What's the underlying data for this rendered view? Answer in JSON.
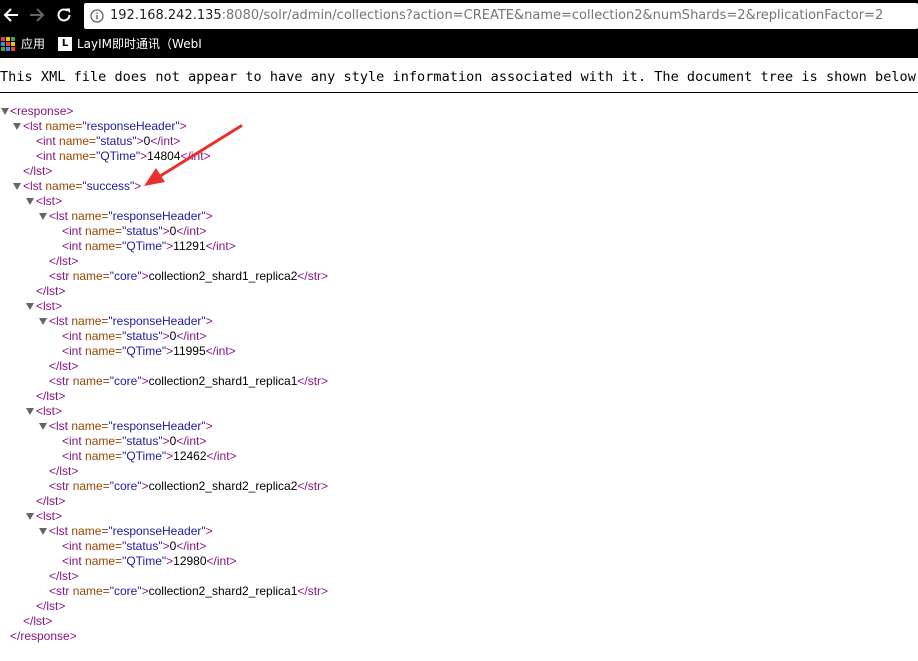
{
  "browser": {
    "url_host": "192.168.242.135",
    "url_rest": ":8080/solr/admin/collections?action=CREATE&name=collection2&numShards=2&replicationFactor=2",
    "bookmarks": [
      {
        "label": "应用"
      },
      {
        "label": "LayIM即时通讯（WebI"
      }
    ],
    "colors": {
      "chrome_bg": "#000000",
      "tag": "#881280",
      "attr_name": "#994500",
      "attr_value": "#1a1aa6",
      "annotation_arrow": "#e8312c"
    }
  },
  "notice": "This XML file does not appear to have any style information associated with it. The document tree is shown below.",
  "xml": {
    "response_open": "<response>",
    "response_close": "</response>",
    "lst_open": "<lst",
    "lst_close": "</lst>",
    "lst_bare": "<lst>",
    "int_open": "<int",
    "int_close": "</int>",
    "str_open": "<str",
    "str_close": "</str>",
    "gt": ">",
    "attr_name": "name=",
    "header": {
      "name": "\"responseHeader\"",
      "status_name": "\"status\"",
      "status_value": "0",
      "qtime_name": "\"QTime\"",
      "qtime_value": "14804"
    },
    "success_name": "\"success\"",
    "core_attr": "\"core\"",
    "shards": [
      {
        "status": "0",
        "qtime": "11291",
        "core": "collection2_shard1_replica2"
      },
      {
        "status": "0",
        "qtime": "11995",
        "core": "collection2_shard1_replica1"
      },
      {
        "status": "0",
        "qtime": "12462",
        "core": "collection2_shard2_replica2"
      },
      {
        "status": "0",
        "qtime": "12980",
        "core": "collection2_shard2_replica1"
      }
    ]
  }
}
